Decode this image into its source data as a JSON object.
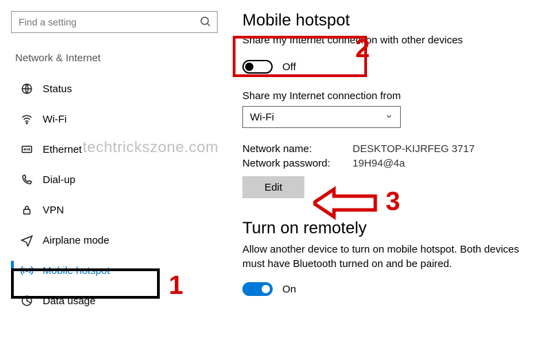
{
  "search": {
    "placeholder": "Find a setting"
  },
  "sidebar": {
    "title": "Network & Internet",
    "items": [
      {
        "label": "Status"
      },
      {
        "label": "Wi-Fi"
      },
      {
        "label": "Ethernet"
      },
      {
        "label": "Dial-up"
      },
      {
        "label": "VPN"
      },
      {
        "label": "Airplane mode"
      },
      {
        "label": "Mobile hotspot"
      },
      {
        "label": "Data usage"
      }
    ]
  },
  "main": {
    "title": "Mobile hotspot",
    "share_label": "Share my Internet connection with other devices",
    "share_toggle_state": "Off",
    "share_from_label": "Share my Internet connection from",
    "share_from_value": "Wi-Fi",
    "network_name_label": "Network name:",
    "network_name_value": "DESKTOP-KIJRFEG 3717",
    "network_password_label": "Network password:",
    "network_password_value": "19H94@4a",
    "edit_label": "Edit",
    "remote": {
      "title": "Turn on remotely",
      "desc": "Allow another device to turn on mobile hotspot. Both devices must have Bluetooth turned on and be paired.",
      "toggle_state": "On"
    }
  },
  "annotations": {
    "n1": "1",
    "n2": "2",
    "n3": "3",
    "watermark": "techtrickszone.com"
  }
}
